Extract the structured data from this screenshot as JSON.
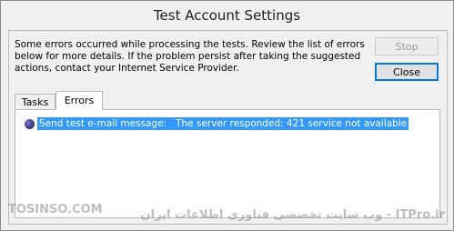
{
  "window": {
    "title": "Test Account Settings"
  },
  "message": "Some errors occurred while processing the tests. Review the list of errors below for more details. If the problem persist after taking the suggested actions, contact your Internet Service Provider.",
  "buttons": {
    "stop": "Stop",
    "close": "Close"
  },
  "tabs": [
    {
      "label": "Tasks",
      "selected": false
    },
    {
      "label": "Errors",
      "selected": true
    }
  ],
  "errors": [
    {
      "text": "Send test e-mail message:   The server responded: 421 service not available",
      "icon": "error-orb-icon",
      "selected": true
    }
  ],
  "watermark": {
    "left": "TOSINSO.COM",
    "right": "وب سایت تخصصی فناوری اطلاعات ایران - ITPro.ir"
  }
}
